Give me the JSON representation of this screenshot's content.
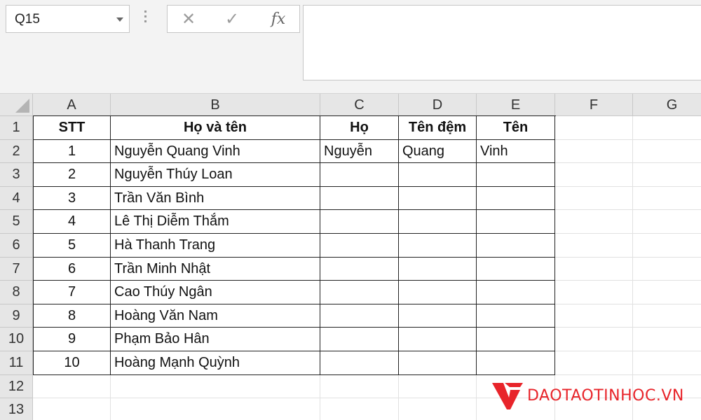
{
  "formula_bar": {
    "name_box": "Q15",
    "cancel_icon": "✕",
    "enter_icon": "✓",
    "fx_label": "fx",
    "formula": ""
  },
  "columns": [
    "A",
    "B",
    "C",
    "D",
    "E",
    "F",
    "G"
  ],
  "rows": [
    "1",
    "2",
    "3",
    "4",
    "5",
    "6",
    "7",
    "8",
    "9",
    "10",
    "11",
    "12",
    "13"
  ],
  "table": {
    "headers": [
      "STT",
      "Họ và tên",
      "Họ",
      "Tên đệm",
      "Tên"
    ],
    "data": [
      [
        "1",
        "Nguyễn Quang Vinh",
        "Nguyễn",
        "Quang",
        "Vinh"
      ],
      [
        "2",
        "Nguyễn Thúy Loan",
        "",
        "",
        ""
      ],
      [
        "3",
        "Trần Văn Bình",
        "",
        "",
        ""
      ],
      [
        "4",
        "Lê Thị Diễm Thắm",
        "",
        "",
        ""
      ],
      [
        "5",
        "Hà Thanh Trang",
        "",
        "",
        ""
      ],
      [
        "6",
        "Trần Minh Nhật",
        "",
        "",
        ""
      ],
      [
        "7",
        "Cao Thúy Ngân",
        "",
        "",
        ""
      ],
      [
        "8",
        "Hoàng Văn Nam",
        "",
        "",
        ""
      ],
      [
        "9",
        "Phạm Bảo Hân",
        "",
        "",
        ""
      ],
      [
        "10",
        "Hoàng Mạnh Quỳnh",
        "",
        "",
        ""
      ]
    ]
  },
  "watermark": {
    "text": "DAOTAOTINHOC.VN",
    "color": "#e8242a"
  },
  "colors": {
    "header_bg": "#e6e6e6",
    "gridline": "#e1e1e1",
    "table_border": "#222222"
  }
}
